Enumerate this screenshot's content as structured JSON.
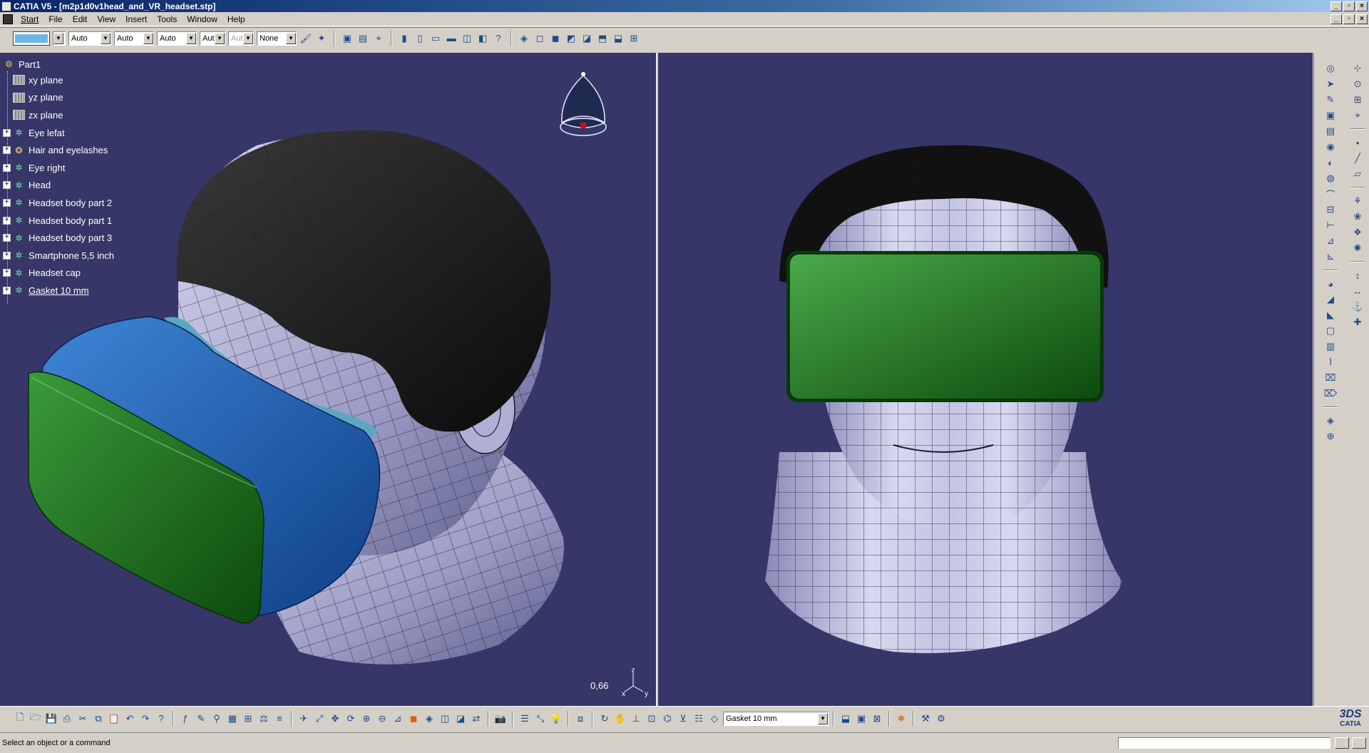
{
  "window": {
    "title": "CATIA V5 - [m2p1d0v1head_and_VR_headset.stp]",
    "controls": [
      "_",
      "▫",
      "×"
    ]
  },
  "menu": {
    "items": [
      "Start",
      "File",
      "Edit",
      "View",
      "Insert",
      "Tools",
      "Window",
      "Help"
    ],
    "doc_controls": [
      "_",
      "▫",
      "×"
    ]
  },
  "toolbar_top": {
    "color_value": "#6fb6e8",
    "transparency": "Auto",
    "line_thickness": "Auto",
    "line_type": "Auto",
    "layer": "Aut",
    "render_style": "Aut",
    "none_select": "None"
  },
  "tree": {
    "root": "Part1",
    "items": [
      {
        "label": "xy plane",
        "kind": "plane",
        "expandable": false
      },
      {
        "label": "yz plane",
        "kind": "plane",
        "expandable": false
      },
      {
        "label": "zx plane",
        "kind": "plane",
        "expandable": false
      },
      {
        "label": "Eye lefat",
        "kind": "body",
        "expandable": true
      },
      {
        "label": "Hair and eyelashes",
        "kind": "hair",
        "expandable": true
      },
      {
        "label": "Eye right",
        "kind": "body",
        "expandable": true
      },
      {
        "label": "Head",
        "kind": "body",
        "expandable": true
      },
      {
        "label": "Headset body part 2",
        "kind": "body",
        "expandable": true
      },
      {
        "label": "Headset body part 1",
        "kind": "body",
        "expandable": true
      },
      {
        "label": "Headset body part 3",
        "kind": "body",
        "expandable": true
      },
      {
        "label": "Smartphone 5,5 inch",
        "kind": "body",
        "expandable": true
      },
      {
        "label": "Headset cap",
        "kind": "body",
        "expandable": true
      },
      {
        "label": "Gasket 10 mm",
        "kind": "body",
        "expandable": true,
        "selected": true
      }
    ]
  },
  "viewport_left": {
    "zoom_readout": "0,66",
    "axes": {
      "z": "z",
      "x": "x",
      "y": "y"
    }
  },
  "toolbar_bottom": {
    "current_feature": "Gasket 10 mm"
  },
  "brand": {
    "logo_text": "CATIA"
  },
  "status": {
    "message": "Select an object or a command"
  },
  "colors": {
    "viewport_bg": "#363768",
    "headset_green": "#1e7a1e",
    "headset_blue": "#1f5fb0",
    "skin": "#b8b8d8",
    "hair": "#151515"
  }
}
